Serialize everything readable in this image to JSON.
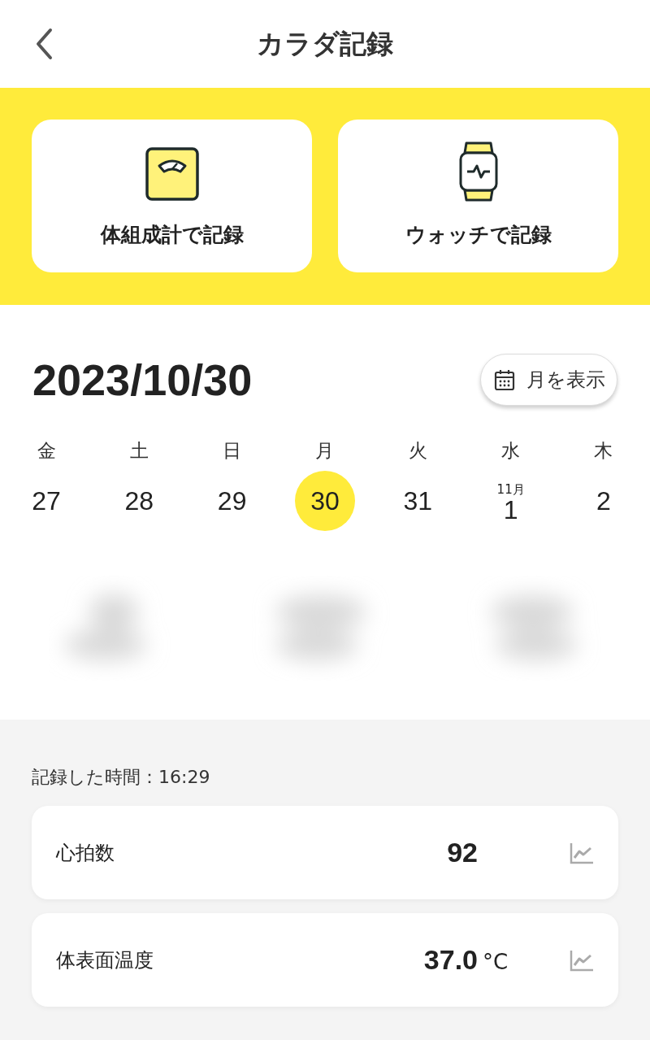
{
  "header": {
    "title": "カラダ記録"
  },
  "record_buttons": [
    {
      "kind": "scale",
      "label": "体組成計で記録"
    },
    {
      "kind": "watch",
      "label": "ウォッチで記録"
    }
  ],
  "date": "2023/10/30",
  "month_button": {
    "label": "月を表示"
  },
  "week": [
    {
      "weekday": "金",
      "day": "27",
      "selected": false
    },
    {
      "weekday": "土",
      "day": "28",
      "selected": false
    },
    {
      "weekday": "日",
      "day": "29",
      "selected": false
    },
    {
      "weekday": "月",
      "day": "30",
      "selected": true
    },
    {
      "weekday": "火",
      "day": "31",
      "selected": false
    },
    {
      "weekday": "水",
      "day": "1",
      "month": "11月",
      "selected": false
    },
    {
      "weekday": "木",
      "day": "2",
      "selected": false
    }
  ],
  "recorded_time": "記録した時間：16:29",
  "measurements": [
    {
      "name": "心拍数",
      "value": "92"
    },
    {
      "name": "体表面温度",
      "value": "37.0",
      "unit": "°C"
    }
  ]
}
